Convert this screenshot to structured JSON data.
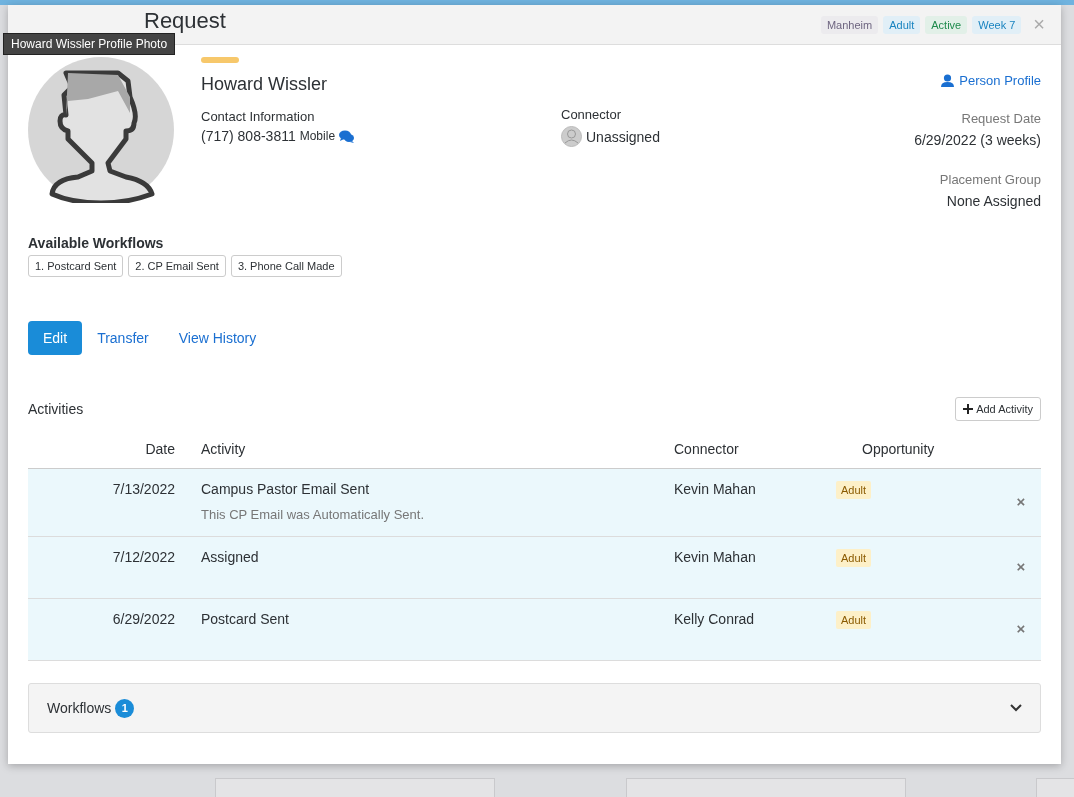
{
  "window": {
    "title": "Request",
    "tags": [
      {
        "label": "Manheim",
        "color": "#6e6580"
      },
      {
        "label": "Adult",
        "color": "#1a84c0"
      },
      {
        "label": "Active",
        "color": "#1e8a4c"
      },
      {
        "label": "Week 7",
        "color": "#1a84c0"
      }
    ],
    "close": "×"
  },
  "tooltip": "Howard Wissler Profile Photo",
  "person": {
    "name": "Howard Wissler",
    "contact_label": "Contact Information",
    "phone": "(717) 808-3811",
    "phone_type": "Mobile",
    "connector_label": "Connector",
    "connector": "Unassigned",
    "profile_link": "Person Profile",
    "request_date_label": "Request Date",
    "request_date": "6/29/2022 (3 weeks)",
    "placement_label": "Placement Group",
    "placement": "None Assigned"
  },
  "available_workflows": {
    "title": "Available Workflows",
    "items": [
      "1. Postcard Sent",
      "2. CP Email Sent",
      "3. Phone Call Made"
    ]
  },
  "actions": [
    {
      "label": "Edit",
      "kind": "primary"
    },
    {
      "label": "Transfer",
      "kind": "link"
    },
    {
      "label": "View History",
      "kind": "link"
    }
  ],
  "activities": {
    "title": "Activities",
    "add_button": "Add Activity",
    "columns": [
      "Date",
      "Activity",
      "Connector",
      "Opportunity"
    ],
    "rows": [
      {
        "date": "7/13/2022",
        "activity": "Campus Pastor Email Sent",
        "note": "This CP Email was Automatically Sent.",
        "connector": "Kevin Mahan",
        "opportunity": "Adult"
      },
      {
        "date": "7/12/2022",
        "activity": "Assigned",
        "connector": "Kevin Mahan",
        "opportunity": "Adult"
      },
      {
        "date": "6/29/2022",
        "activity": "Postcard Sent",
        "connector": "Kelly Conrad",
        "opportunity": "Adult"
      }
    ]
  },
  "workflows_panel": {
    "title": "Workflows",
    "count": "1",
    "expanded": false
  }
}
